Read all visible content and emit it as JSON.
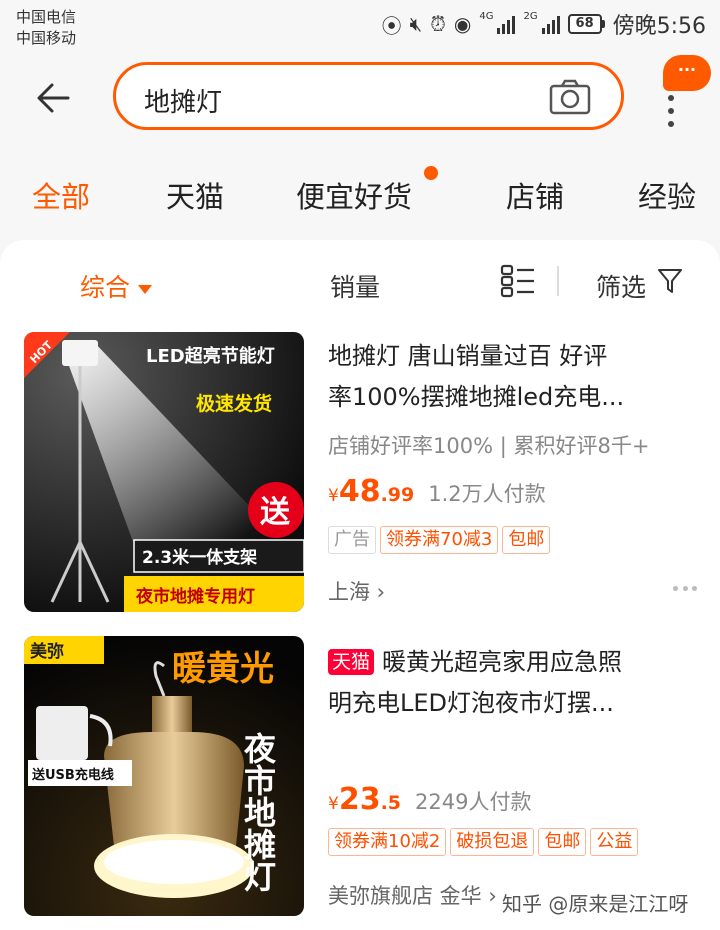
{
  "status_bar": {
    "carrier1": "中国电信",
    "carrier2": "中国移动",
    "net1": "4G",
    "net2": "2G",
    "battery": "68",
    "time": "傍晚5:56"
  },
  "search": {
    "query": "地摊灯",
    "more_label": "···"
  },
  "category_tabs": [
    {
      "label": "全部",
      "active": true
    },
    {
      "label": "天猫",
      "active": false
    },
    {
      "label": "便宜好货",
      "active": false
    },
    {
      "label": "店铺",
      "active": false
    },
    {
      "label": "经验",
      "active": false
    }
  ],
  "sort_bar": {
    "default_label": "综合",
    "sales_label": "销量",
    "filter_label": "筛选"
  },
  "products": [
    {
      "title_line1": "地摊灯 唐山销量过百 好评",
      "title_line2": "率100%摆摊地摊led充电...",
      "shop_info": "店铺好评率100% | 累积好评8千+",
      "currency": "¥",
      "price_int": "48",
      "price_dec": ".99",
      "sold": "1.2万人付款",
      "tags": [
        "广告",
        "领券满70减3",
        "包邮"
      ],
      "location": "上海",
      "image_text": {
        "hot": "HOT",
        "title": "LED超亮节能灯",
        "fast": "极速发货",
        "gift": "送",
        "stand": "2.3米一体支架",
        "bottom": "夜市地摊专用灯"
      }
    },
    {
      "tmall_tag": "天猫",
      "title_line1": "暖黄光超亮家用应急照",
      "title_line2": "明充电LED灯泡夜市灯摆...",
      "currency": "¥",
      "price_int": "23",
      "price_dec": ".5",
      "sold": "2249人付款",
      "tags": [
        "领券满10减2",
        "破损包退",
        "包邮",
        "公益"
      ],
      "shop": "美弥旗舰店 金华",
      "image_text": {
        "brand": "美弥",
        "headline": "暖黄光",
        "side": "夜市地摊灯",
        "usb": "送USB充电线"
      }
    }
  ],
  "watermark": "知乎 @原来是江江呀"
}
